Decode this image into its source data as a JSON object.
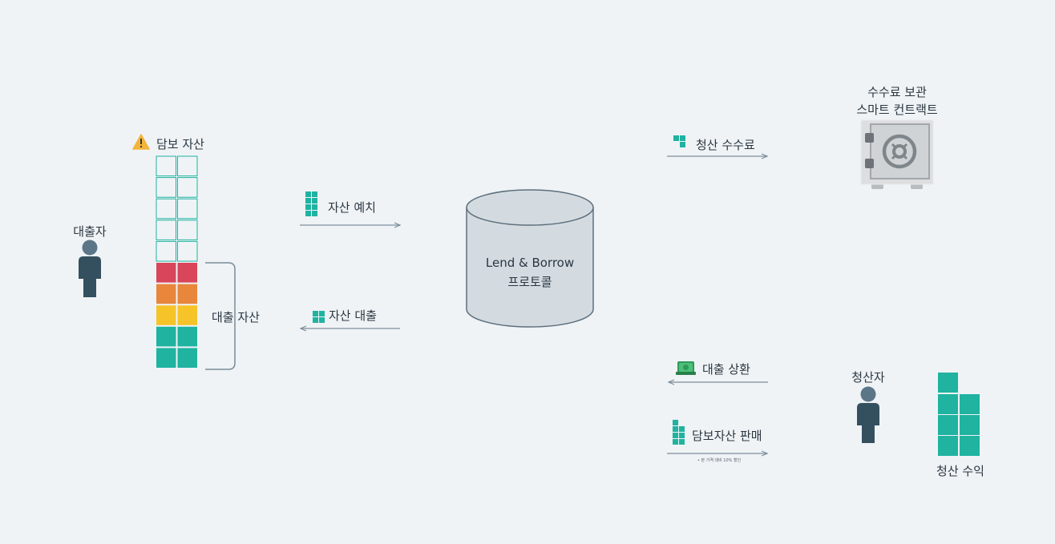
{
  "borrower": {
    "label": "대출자"
  },
  "collateral": {
    "label": "담보 자산",
    "warning_icon": "warning-icon"
  },
  "loan": {
    "label": "대출 자산"
  },
  "deposit": {
    "label": "자산 예치"
  },
  "borrow": {
    "label": "자산 대출"
  },
  "protocol": {
    "line1": "Lend & Borrow",
    "line2": "프로토콜"
  },
  "fee": {
    "label": "청산 수수료"
  },
  "vault": {
    "line1": "수수료 보관",
    "line2": "스마트 컨트랙트",
    "icon": "safe-icon"
  },
  "repay": {
    "label": "대출 상환",
    "icon": "cash-icon"
  },
  "sale": {
    "label": "담보자산 판매",
    "note": "• 본 가격 대비 10% 할인"
  },
  "liquidator": {
    "label": "청산자"
  },
  "profit": {
    "label": "청산 수익"
  },
  "colors": {
    "teal": "#1fb3a0",
    "red": "#d9455a",
    "orange": "#e8863c",
    "yellow": "#f6c429",
    "person": "#34505f",
    "person_head": "#5b7686",
    "arrow": "#7e8f9c",
    "bracket": "#7b8b97",
    "cylinder_fill": "#d3dbe1",
    "cylinder_stroke": "#5e6f7b"
  }
}
